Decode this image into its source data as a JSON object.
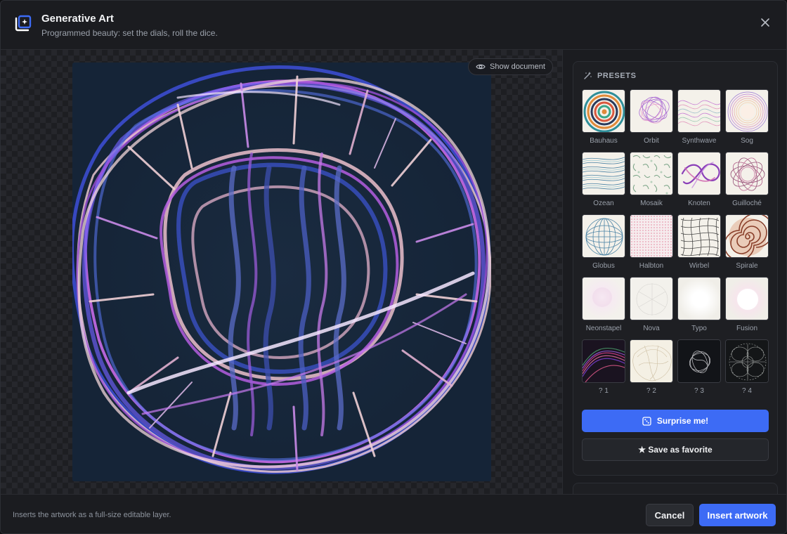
{
  "header": {
    "title": "Generative Art",
    "subtitle": "Programmed beauty: set the dials, roll the dice.",
    "logo_icon": "sparkle-frame-icon",
    "close_icon": "close-icon"
  },
  "canvas": {
    "show_document_label": "Show document",
    "show_document_icon": "eye-icon"
  },
  "presets": {
    "heading": "PRESETS",
    "heading_icon": "magic-wand-icon",
    "items": [
      {
        "label": "Bauhaus"
      },
      {
        "label": "Orbit"
      },
      {
        "label": "Synthwave"
      },
      {
        "label": "Sog"
      },
      {
        "label": "Ozean"
      },
      {
        "label": "Mosaik"
      },
      {
        "label": "Knoten"
      },
      {
        "label": "Guilloché"
      },
      {
        "label": "Globus"
      },
      {
        "label": "Halbton"
      },
      {
        "label": "Wirbel"
      },
      {
        "label": "Spirale"
      },
      {
        "label": "Neonstapel"
      },
      {
        "label": "Nova"
      },
      {
        "label": "Typo"
      },
      {
        "label": "Fusion"
      },
      {
        "label": "? 1"
      },
      {
        "label": "? 2"
      },
      {
        "label": "? 3"
      },
      {
        "label": "? 4"
      }
    ],
    "surprise_label": "Surprise me!",
    "surprise_icon": "dice-icon",
    "favorite_label": "★ Save as favorite"
  },
  "footer": {
    "note": "Inserts the artwork as a full-size editable layer.",
    "cancel_label": "Cancel",
    "insert_label": "Insert artwork"
  },
  "colors": {
    "accent": "#3d6bf5",
    "background": "#1b1c20",
    "artwork_bg": "#17263a"
  }
}
